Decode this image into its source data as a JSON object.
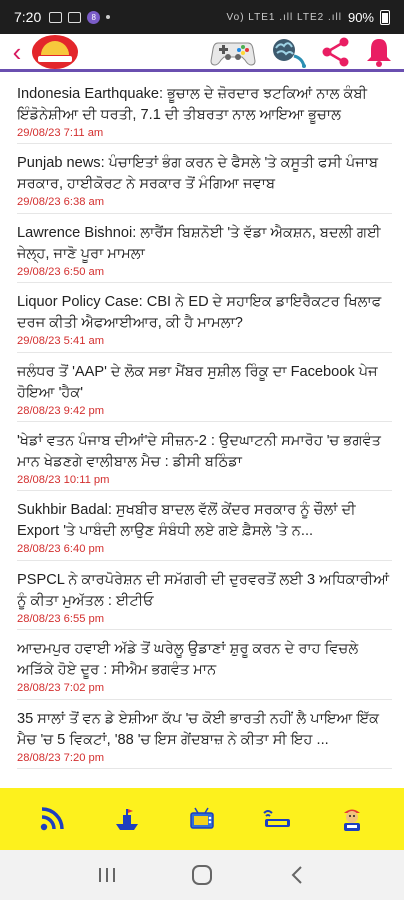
{
  "status_bar": {
    "time": "7:20",
    "network": "Vo) LTE1 .ıll LTE2 .ıll",
    "battery": "90%"
  },
  "header": {
    "back_icon": "chevron-left-icon",
    "logo": "app-logo",
    "icons": [
      "gamepad-icon",
      "brain-icon",
      "share-icon",
      "bell-icon"
    ],
    "accent_color": "#e91e63",
    "underline_color": "#6a4fb0"
  },
  "feed": {
    "items": [
      {
        "title": "Indonesia Earthquake: ਭੂਚਾਲ ਦੇ ਜ਼ੋਰਦਾਰ ਝਟਕਿਆਂ ਨਾਲ ਕੰਬੀ ਇੰਡੋਨੇਸ਼ੀਆ ਦੀ ਧਰਤੀ, 7.1 ਦੀ ਤੀਬਰਤਾ ਨਾਲ ਆਇਆ ਭੂਚਾਲ",
        "date": "29/08/23 7:11 am"
      },
      {
        "title": "Punjab news: ਪੰਚਾਇਤਾਂ ਭੰਗ ਕਰਨ ਦੇ ਫੈਸਲੇ 'ਤੇ ਕਸੂਤੀ ਫਸੀ ਪੰਜਾਬ ਸਰਕਾਰ, ਹਾਈਕੋਰਟ ਨੇ ਸਰਕਾਰ ਤੋਂ ਮੰਗਿਆ ਜਵਾਬ",
        "date": "29/08/23 6:38 am"
      },
      {
        "title": "Lawrence Bishnoi: ਲਾਰੈਂਸ ਬਿਸ਼ਨੋਈ 'ਤੇ ਵੱਡਾ ਐਕਸ਼ਨ, ਬਦਲੀ ਗਈ ਜੇਲ੍ਹ, ਜਾਣੋ ਪੂਰਾ ਮਾਮਲਾ",
        "date": "29/08/23 6:50 am"
      },
      {
        "title": "Liquor Policy Case: CBI ਨੇ ED ਦੇ ਸਹਾਇਕ ਡਾਇਰੈਕਟਰ ਖਿਲਾਫ ਦਰਜ ਕੀਤੀ ਐਫਆਈਆਰ, ਕੀ ਹੈ ਮਾਮਲਾ?",
        "date": "29/08/23 5:41 am"
      },
      {
        "title": "ਜਲੰਧਰ ਤੋਂ 'AAP' ਦੇ ਲੋਕ ਸਭਾ ਮੈਂਬਰ ਸੁਸ਼ੀਲ ਰਿੰਕੂ ਦਾ Facebook ਪੇਜ ਹੋਇਆ 'ਹੈਕ'",
        "date": "28/08/23 9:42 pm"
      },
      {
        "title": "'ਖੇਡਾਂ ਵਤਨ ਪੰਜਾਬ ਦੀਆਂ'ਦੇ ਸੀਜ਼ਨ-2 : ਉਦਘਾਟਨੀ ਸਮਾਰੋਹ 'ਚ ਭਗਵੰਤ ਮਾਨ ਖੇਡਣਗੇ ਵਾਲੀਬਾਲ ਮੈਚ : ਡੀਸੀ ਬਠਿੰਡਾ",
        "date": "28/08/23 10:11 pm"
      },
      {
        "title": "Sukhbir Badal: ਸੁਖਬੀਰ ਬਾਦਲ ਵੱਲੋਂ ਕੇਂਦਰ ਸਰਕਾਰ ਨੂੰ ਚੌਲਾਂ ਦੀ Export 'ਤੇ ਪਾਬੰਦੀ ਲਾਉਣ ਸੰਬੰਧੀ ਲਏ ਗਏ ਫ਼ੈਸਲੇ 'ਤੇ ਨ...",
        "date": "28/08/23 6:40 pm"
      },
      {
        "title": "PSPCL ਨੇ ਕਾਰਪੋਰੇਸ਼ਨ ਦੀ ਸਮੱਗਰੀ ਦੀ ਦੁਰਵਰਤੋਂ ਲਈ 3 ਅਧਿਕਾਰੀਆਂ ਨੂੰ ਕੀਤਾ ਮੁਅੱਤਲ : ਈਟੀਓ",
        "date": "28/08/23 6:55 pm"
      },
      {
        "title": "ਆਦਮਪੁਰ ਹਵਾਈ ਅੱਡੇ ਤੋਂ ਘਰੇਲੂ ਉਡਾਣਾਂ ਸ਼ੁਰੂ ਕਰਨ ਦੇ ਰਾਹ ਵਿਚਲੇ ਅੜਿੱਕੇ ਹੋਏ ਦੂਰ : ਸੀਐਮ ਭਗਵੰਤ ਮਾਨ",
        "date": "28/08/23 7:02 pm"
      },
      {
        "title": "35 ਸਾਲਾਂ ਤੋਂ ਵਨ ਡੇ ਏਸ਼ੀਆ ਕੱਪ 'ਚ ਕੋਈ ਭਾਰਤੀ ਨਹੀਂ ਲੈ ਪਾਇਆ ਇੱਕ ਮੈਚ 'ਚ 5 ਵਿਕਟਾਂ, '88 'ਚ ਇਸ ਗੇਂਦਬਾਜ਼ ਨੇ ਕੀਤਾ ਸੀ ਇਹ ...",
        "date": "28/08/23 7:20 pm"
      }
    ]
  },
  "tabbar": {
    "background": "#fdf11d",
    "tabs": [
      "rss-feed-icon",
      "news-ship-icon",
      "tv-icon",
      "live-news-icon",
      "mascot-icon"
    ]
  },
  "system_nav": {
    "buttons": [
      "recents-icon",
      "home-icon",
      "back-icon"
    ]
  }
}
